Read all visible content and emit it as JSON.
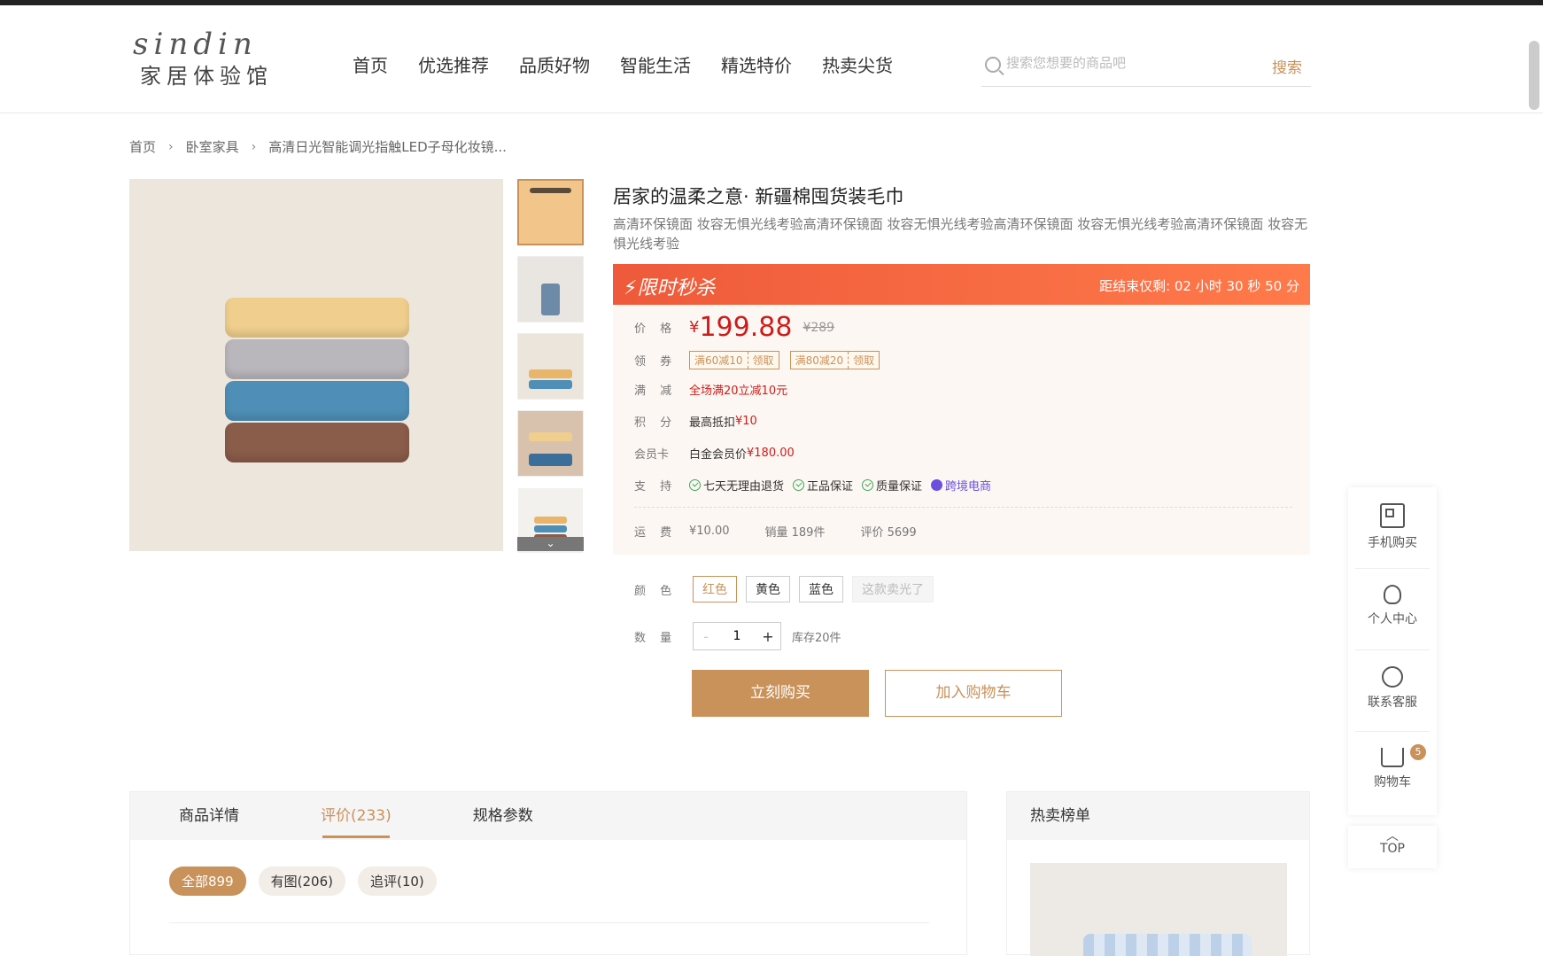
{
  "brand": {
    "logo_en": "sindin",
    "logo_cn": "家居体验馆"
  },
  "nav": [
    "首页",
    "优选推荐",
    "品质好物",
    "智能生活",
    "精选特价",
    "热卖尖货"
  ],
  "search": {
    "placeholder": "搜索您想要的商品吧",
    "button": "搜索"
  },
  "breadcrumb": [
    "首页",
    "卧室家具",
    "高清日光智能调光指触LED子母化妆镜..."
  ],
  "product": {
    "title": "居家的温柔之意· 新疆棉囤货装毛巾",
    "subtitle": "高清环保镜面 妆容无惧光线考验高清环保镜面 妆容无惧光线考验高清环保镜面 妆容无惧光线考验高清环保镜面 妆容无惧光线考验",
    "flash_title": "限时秒杀",
    "countdown": "距结束仅剩: 02 小时 30 秒 50 分",
    "price_label": "价 格",
    "currency": "¥",
    "price": "199.88",
    "price_old": "¥289",
    "coupon_label": "领 券",
    "coupons": [
      {
        "text": "满60减10",
        "action": "领取"
      },
      {
        "text": "满80减20",
        "action": "领取"
      }
    ],
    "discount_label": "满 减",
    "discount": "全场满20立减10元",
    "points_label": "积 分",
    "points_prefix": "最高抵扣",
    "points_value": "¥10",
    "member_label": "会员卡",
    "member_prefix": "白金会员价",
    "member_value": "¥180.00",
    "support_label": "支 持",
    "supports": [
      "七天无理由退货",
      "正品保证",
      "质量保证"
    ],
    "cross_border": "跨境电商",
    "shipping_label": "运 费",
    "shipping": "¥10.00",
    "sales": "销量 189件",
    "reviews": "评价 5699",
    "color_label": "颜 色",
    "colors": [
      "红色",
      "黄色",
      "蓝色"
    ],
    "sold_out": "这款卖光了",
    "qty_label": "数 量",
    "qty_value": "1",
    "qty_minus": "-",
    "qty_plus": "+",
    "stock": "库存20件",
    "buy_now": "立刻购买",
    "add_cart": "加入购物车"
  },
  "tabs": [
    "商品详情",
    "评价(233)",
    "规格参数"
  ],
  "review_filters": [
    "全部899",
    "有图(206)",
    "追评(10)"
  ],
  "hot_title": "热卖榜单",
  "sidebar": {
    "items": [
      "手机购买",
      "个人中心",
      "联系客服",
      "购物车"
    ],
    "cart_count": "5",
    "top": "TOP"
  },
  "colors_theme": {
    "accent": "#c8925a",
    "price": "#cc1d1d",
    "flash": "#ee5a3a"
  }
}
